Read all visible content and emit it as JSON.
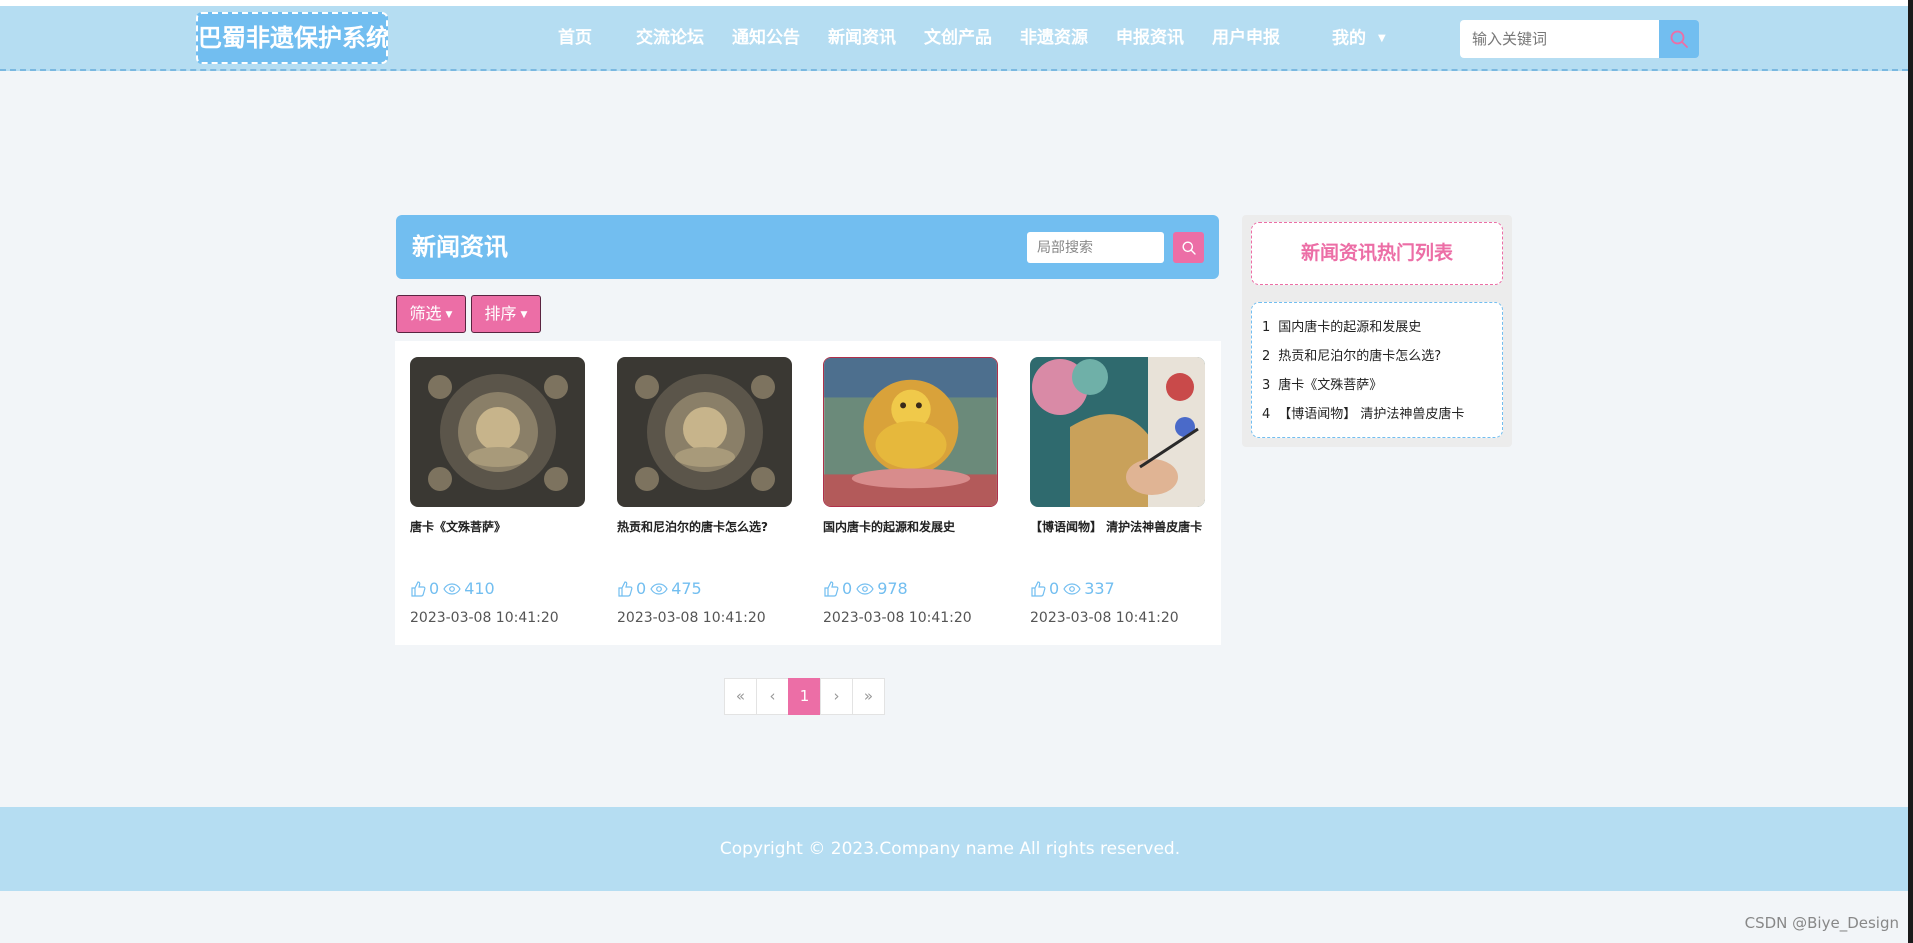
{
  "header": {
    "logo": "巴蜀非遗保护系统",
    "nav": [
      "首页",
      "交流论坛",
      "通知公告",
      "新闻资讯",
      "文创产品",
      "非遗资源",
      "申报资讯",
      "用户申报"
    ],
    "mine": "我的",
    "search_placeholder": "输入关键词",
    "search_icon": "search-icon"
  },
  "main": {
    "title": "新闻资讯",
    "local_search_placeholder": "局部搜索",
    "filter_label": "筛选",
    "sort_label": "排序",
    "cards": [
      {
        "title": "唐卡《文殊菩萨》",
        "likes": "0",
        "views": "410",
        "date": "2023-03-08 10:41:20",
        "image": "thangka-dark"
      },
      {
        "title": "热贡和尼泊尔的唐卡怎么选?",
        "likes": "0",
        "views": "475",
        "date": "2023-03-08 10:41:20",
        "image": "thangka-dark"
      },
      {
        "title": "国内唐卡的起源和发展史",
        "likes": "0",
        "views": "978",
        "date": "2023-03-08 10:41:20",
        "image": "thangka-colorful"
      },
      {
        "title": "【博语闻物】 清护法神兽皮唐卡",
        "likes": "0",
        "views": "337",
        "date": "2023-03-08 10:41:20",
        "image": "painting-hand"
      }
    ]
  },
  "pager": {
    "first": "«",
    "prev": "‹",
    "current": "1",
    "next": "›",
    "last": "»"
  },
  "side": {
    "title": "新闻资讯热门列表",
    "items": [
      {
        "index": "1",
        "label": "国内唐卡的起源和发展史"
      },
      {
        "index": "2",
        "label": "热贡和尼泊尔的唐卡怎么选?"
      },
      {
        "index": "3",
        "label": "唐卡《文殊菩萨》"
      },
      {
        "index": "4",
        "label": "【博语闻物】 清护法神兽皮唐卡"
      }
    ]
  },
  "footer": {
    "copyright": "Copyright © 2023.Company name All rights reserved."
  },
  "watermark": "CSDN @Biye_Design",
  "colors": {
    "header_bg": "#b5ddf2",
    "accent_blue": "#72bef0",
    "accent_pink": "#ec6ea6",
    "page_bg": "#f2f5f8"
  }
}
